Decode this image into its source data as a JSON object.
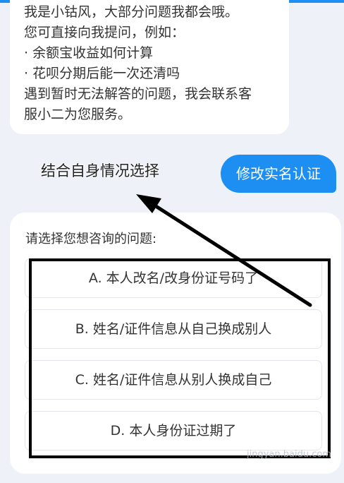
{
  "bot_message": {
    "lines": [
      "我是小钴风，大部分问题我都会哦。",
      "您可直接向我提问，例如：",
      "· 余额宝收益如何计算",
      "· 花呗分期后能一次还清吗",
      "遇到暂时无法解答的问题，我会联系客",
      "服小二为您服务。"
    ]
  },
  "annotation": {
    "text": "结合自身情况选择"
  },
  "user_message": {
    "text": "修改实名认证"
  },
  "question_card": {
    "prompt": "请选择您想咨询的问题:",
    "options": [
      "A. 本人改名/改身份证号码了",
      "B. 姓名/证件信息从自己换成别人",
      "C. 姓名/证件信息从别人换成自己",
      "D. 本人身份证过期了"
    ]
  },
  "watermark": {
    "text": "jingyan.baidu.com"
  },
  "colors": {
    "accent": "#1d8ff2",
    "background": "#eef2f8",
    "card": "#ffffff",
    "markup": "#000000"
  }
}
